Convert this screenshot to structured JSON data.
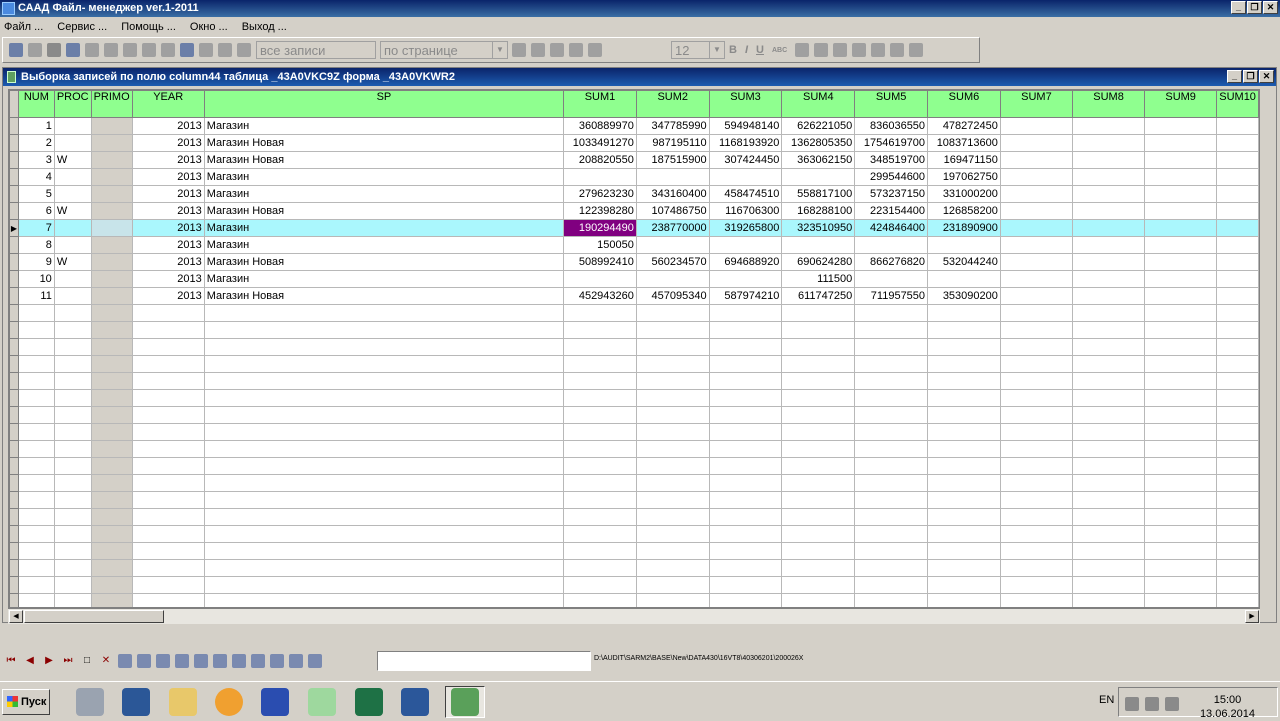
{
  "window": {
    "title": "САAД Файл- менеджер ver.1-2011"
  },
  "menu": [
    "Файл ...",
    "Сервис ...",
    "Помощь ...",
    "Окно ...",
    "Выход ..."
  ],
  "toolbar": {
    "records_combo": "все записи",
    "page_combo": "по странице",
    "font_size": "12",
    "bold": "B",
    "italic": "I",
    "underline": "U",
    "abc": "ABC"
  },
  "child_window": {
    "title": "Выборка записей по полю column44 таблица _43A0VKC9Z форма _43A0VKWR2"
  },
  "grid": {
    "columns": [
      "NUM",
      "PROC",
      "PRIMO",
      "YEAR",
      "SP",
      "SUM1",
      "SUM2",
      "SUM3",
      "SUM4",
      "SUM5",
      "SUM6",
      "SUM7",
      "SUM8",
      "SUM9",
      "SUM10"
    ],
    "rows": [
      [
        "1",
        "",
        "",
        "2013",
        "Магазин",
        "360889970",
        "347785990",
        "594948140",
        "626221050",
        "836036550",
        "478272450",
        "",
        "",
        "",
        ""
      ],
      [
        "2",
        "",
        "",
        "2013",
        "Магазин Новая",
        "1033491270",
        "987195110",
        "1168193920",
        "1362805350",
        "1754619700",
        "1083713600",
        "",
        "",
        "",
        ""
      ],
      [
        "3",
        "W",
        "",
        "2013",
        "Магазин Новая",
        "208820550",
        "187515900",
        "307424450",
        "363062150",
        "348519700",
        "169471150",
        "",
        "",
        "",
        ""
      ],
      [
        "4",
        "",
        "",
        "2013",
        "Магазин",
        "",
        "",
        "",
        "",
        "299544600",
        "197062750",
        "",
        "",
        "",
        ""
      ],
      [
        "5",
        "",
        "",
        "2013",
        "Магазин",
        "279623230",
        "343160400",
        "458474510",
        "558817100",
        "573237150",
        "331000200",
        "",
        "",
        "",
        ""
      ],
      [
        "6",
        "W",
        "",
        "2013",
        "Магазин Новая",
        "122398280",
        "107486750",
        "116706300",
        "168288100",
        "223154400",
        "126858200",
        "",
        "",
        "",
        ""
      ],
      [
        "7",
        "",
        "",
        "2013",
        "Магазин",
        "190294490",
        "238770000",
        "319265800",
        "323510950",
        "424846400",
        "231890900",
        "",
        "",
        "",
        ""
      ],
      [
        "8",
        "",
        "",
        "2013",
        "Магазин",
        "150050",
        "",
        "",
        "",
        "",
        "",
        "",
        "",
        "",
        ""
      ],
      [
        "9",
        "W",
        "",
        "2013",
        "Магазин Новая",
        "508992410",
        "560234570",
        "694688920",
        "690624280",
        "866276820",
        "532044240",
        "",
        "",
        "",
        ""
      ],
      [
        "10",
        "",
        "",
        "2013",
        "Магазин",
        "",
        "",
        "",
        "111500",
        "",
        "",
        "",
        "",
        "",
        ""
      ],
      [
        "11",
        "",
        "",
        "2013",
        "Магазин Новая",
        "452943260",
        "457095340",
        "587974210",
        "611747250",
        "711957550",
        "353090200",
        "",
        "",
        "",
        ""
      ]
    ],
    "selected_row": 6,
    "current_cell_col": 5
  },
  "status": {
    "path": "D:\\AUDIT\\SARM2\\BASE\\New\\DATA430\\16VT8\\40306201\\200026X"
  },
  "taskbar": {
    "start": "Пуск",
    "lang": "EN",
    "time": "15:00",
    "date": "13.06.2014"
  }
}
